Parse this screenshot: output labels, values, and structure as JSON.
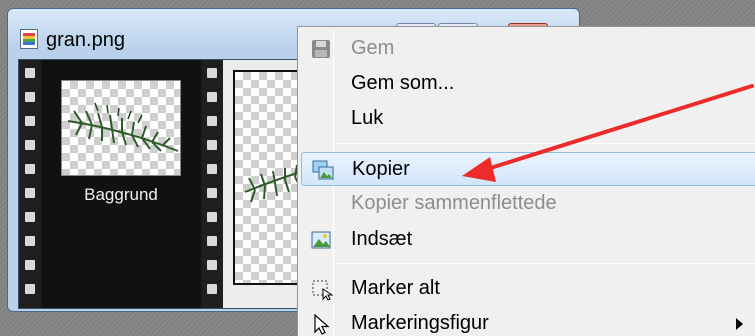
{
  "window": {
    "title": "gran.png",
    "icon": "image-file-icon"
  },
  "filmstrip": {
    "frames": [
      {
        "label": "Baggrund",
        "icon": "pine-branch-thumbnail"
      }
    ]
  },
  "context_menu": {
    "items": [
      {
        "label": "Gem",
        "icon": "save-disk-icon",
        "disabled": true
      },
      {
        "label": "Gem som...",
        "disabled": false
      },
      {
        "label": "Luk",
        "disabled": false
      },
      {
        "label": "Kopier",
        "icon": "copy-image-icon",
        "highlighted": true
      },
      {
        "label": "Kopier sammenflettede",
        "disabled": true
      },
      {
        "label": "Indsæt",
        "icon": "paste-image-icon"
      },
      {
        "label": "Marker alt",
        "icon": "select-all-icon"
      },
      {
        "label": "Markeringsfigur",
        "icon": "cursor-arrow-icon",
        "has_submenu": true
      }
    ]
  },
  "colors": {
    "highlight_border": "#90bbe6",
    "annotation_arrow": "#ee2b2b",
    "disabled_text": "#8d8d8d"
  }
}
